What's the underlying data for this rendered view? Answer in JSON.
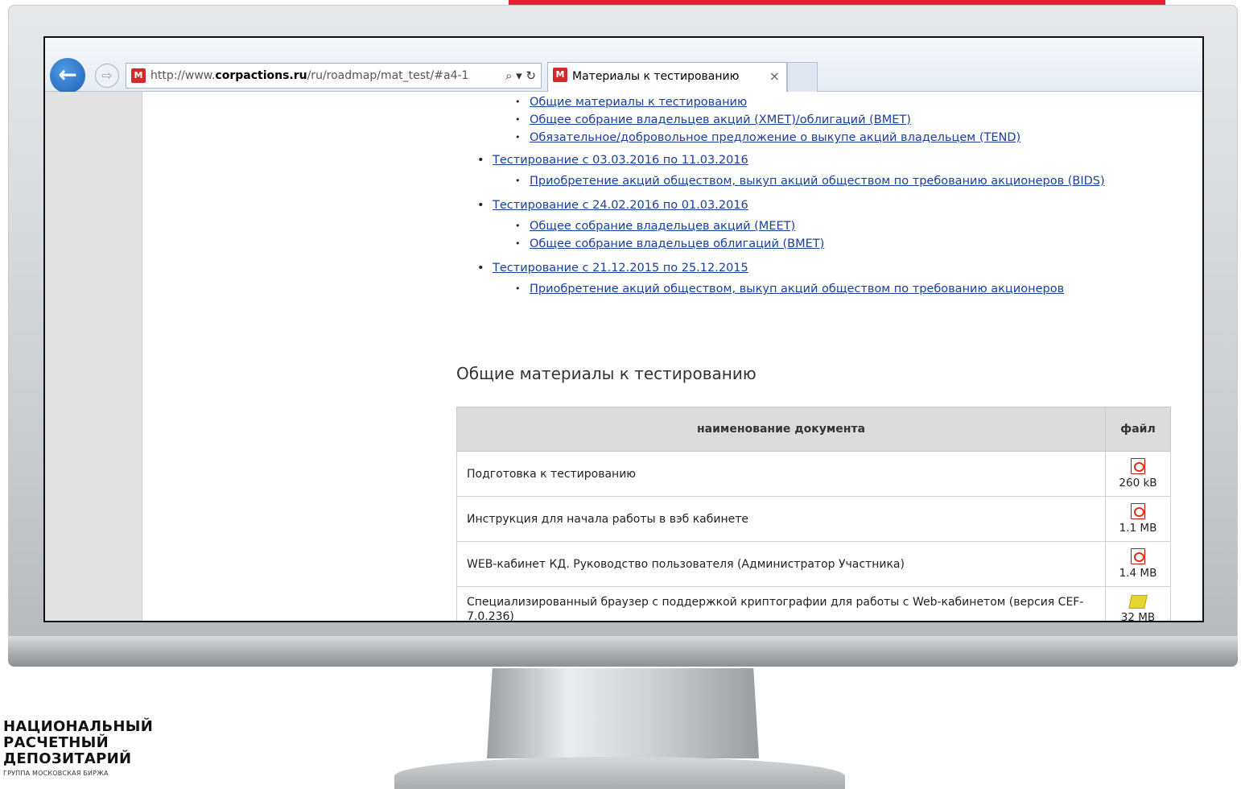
{
  "browser": {
    "address": {
      "prefix": "http://www.",
      "domain": "corpactions.ru",
      "path": "/ru/roadmap/mat_test/#a4-1",
      "icons": "⌕ ▾ ↻"
    },
    "tab": {
      "title": "Материалы к тестированию",
      "close": "×"
    },
    "back": "←",
    "forward": "⇨",
    "favicon": "M"
  },
  "nav": {
    "items": [
      {
        "label": "Общие материалы к тестированию",
        "level": "sub"
      },
      {
        "label": "Общее собрание владельцев акций (XMET)/облигаций (BMET)",
        "level": "sub"
      },
      {
        "label": "Обязательное/добровольное предложение о выкупе акций владельцем (TEND)",
        "level": "sub"
      },
      {
        "label": "Тестирование с 03.03.2016 по 11.03.2016",
        "level": "top"
      },
      {
        "label": "Приобретение акций обществом, выкуп акций обществом по требованию акционеров (BIDS)",
        "level": "sub"
      },
      {
        "label": "Тестирование с 24.02.2016 по 01.03.2016",
        "level": "top"
      },
      {
        "label": "Общее собрание владельцев акций (MEET)",
        "level": "sub"
      },
      {
        "label": "Общее собрание владельцев облигаций (BMET)",
        "level": "sub"
      },
      {
        "label": "Тестирование с 21.12.2015 по 25.12.2015",
        "level": "top"
      },
      {
        "label": "Приобретение акций обществом, выкуп акций обществом по требованию акционеров",
        "level": "sub"
      }
    ]
  },
  "section": {
    "title": "Общие материалы к тестированию"
  },
  "table": {
    "headers": {
      "name": "наименование документа",
      "file": "файл"
    },
    "rows": [
      {
        "name": "Подготовка к тестированию",
        "size": "260 kB",
        "icon": "pdf-icon"
      },
      {
        "name": "Инструкция для начала работы в вэб кабинете",
        "size": "1.1 MB",
        "icon": "pdf-icon"
      },
      {
        "name": "WEB-кабинет КД. Руководство пользователя (Администратор Участника)",
        "size": "1.4 MB",
        "icon": "pdf-icon"
      },
      {
        "name": "Специализированный браузер с поддержкой криптографии для работы с Web-кабинетом (версия CEF-7.0.236)",
        "size": "32 MB",
        "icon": "zip-icon"
      }
    ]
  },
  "logo": {
    "line1": "НАЦИОНАЛЬНЫЙ",
    "line2": "РАСЧЕТНЫЙ",
    "line3": "ДЕПОЗИТАРИЙ",
    "sub": "ГРУППА МОСКОВСКАЯ БИРЖА"
  },
  "colors": {
    "accent": "#e3202f",
    "link": "#1a3f9c",
    "browser_blue": "#1d5fb4"
  }
}
